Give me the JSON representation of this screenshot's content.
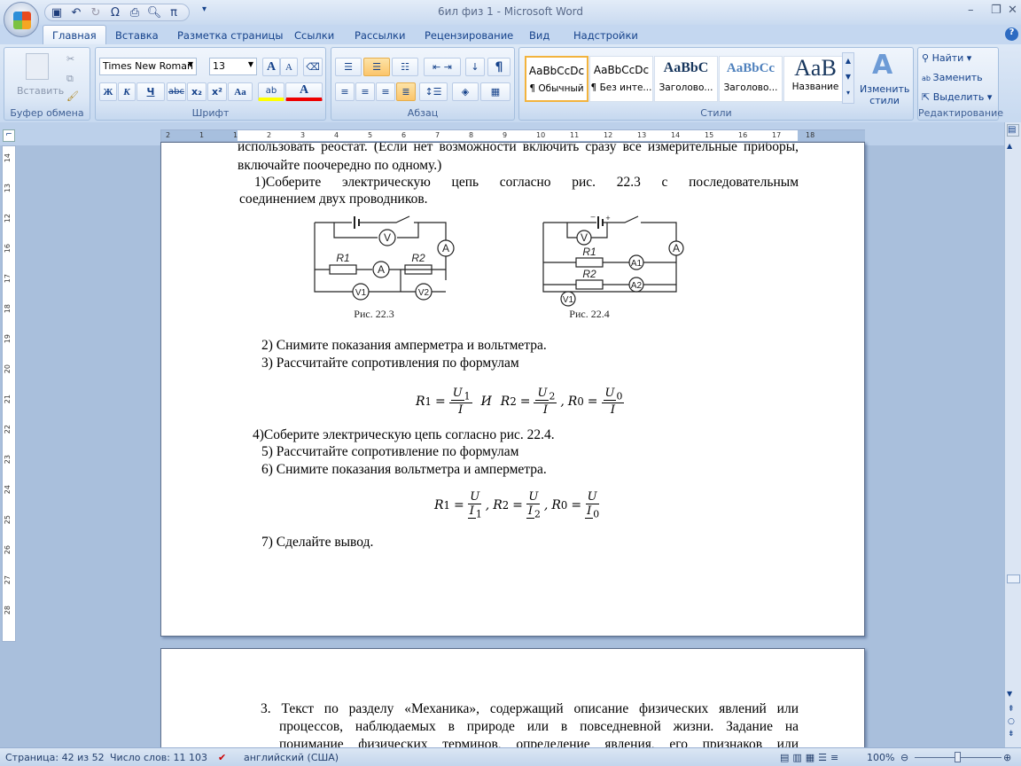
{
  "window": {
    "title": "6ил физ 1 - Microsoft Word",
    "minimize": "–",
    "restore": "❐",
    "close": "✕"
  },
  "qat": {
    "icons": [
      "save-icon",
      "undo-icon",
      "redo-icon",
      "symbol-omega-icon",
      "print-icon",
      "print-preview-icon",
      "pi-equation-icon"
    ],
    "omega": "Ω",
    "pi": "π"
  },
  "tabs": [
    "Главная",
    "Вставка",
    "Разметка страницы",
    "Ссылки",
    "Рассылки",
    "Рецензирование",
    "Вид",
    "Надстройки"
  ],
  "ribbon": {
    "clipboard": {
      "label": "Буфер обмена",
      "paste": "Вставить"
    },
    "font": {
      "label": "Шрифт",
      "name": "Times New Roman",
      "size": "13",
      "bold": "Ж",
      "italic": "К",
      "underline": "Ч",
      "strike": "abc",
      "sub": "x₂",
      "sup": "x²",
      "case": "Aa",
      "grow": "A",
      "shrink": "A",
      "color": "A",
      "highlight": "ab"
    },
    "paragraph": {
      "label": "Абзац",
      "pilcrow": "¶"
    },
    "styles": {
      "label": "Стили",
      "items": [
        {
          "preview": "AaBbCcDc",
          "name": "¶ Обычный"
        },
        {
          "preview": "AaBbCcDc",
          "name": "¶ Без инте..."
        },
        {
          "preview": "AaBbC",
          "name": "Заголово..."
        },
        {
          "preview": "AaBbCc",
          "name": "Заголово..."
        },
        {
          "preview": "AaB",
          "name": "Название"
        }
      ],
      "change": "Изменить стили"
    },
    "editing": {
      "label": "Редактирование",
      "find": "Найти",
      "replace": "Заменить",
      "select": "Выделить"
    }
  },
  "ruler": {
    "h": [
      "2",
      "1",
      "1",
      "2",
      "3",
      "4",
      "5",
      "6",
      "7",
      "8",
      "9",
      "10",
      "11",
      "12",
      "13",
      "14",
      "15",
      "16",
      "17",
      "18"
    ],
    "v": [
      "14",
      "13",
      "12",
      "16",
      "17",
      "18",
      "19",
      "20",
      "21",
      "22",
      "23",
      "24",
      "25",
      "26",
      "27",
      "28"
    ]
  },
  "doc": {
    "p0": "использовать реостат. (Если нет возможности включить сразу все измерительные приборы,",
    "p1": "включайте поочередно по одному.)",
    "s1a": "1)Соберите электрическую цепь согласно рис. 22.3 с последовательным",
    "s1b": "соединением двух проводников.",
    "fig1": {
      "caption": "Рис. 22.3",
      "labels": [
        "V",
        "A",
        "R1",
        "A",
        "R2",
        "V1",
        "V2"
      ]
    },
    "fig2": {
      "caption": "Рис. 22.4",
      "labels": [
        "V",
        "A",
        "R1",
        "A1",
        "R2",
        "A2",
        "V1",
        "–",
        "+"
      ]
    },
    "s2": "2)   Снимите показания амперметра и вольтметра.",
    "s3": "3)   Рассчитайте сопротивления по формулам",
    "f1": {
      "r1": "R",
      "s1": "1",
      "eq": "=",
      "n1": "U",
      "ns1": "1",
      "d1": "I",
      "and": "И",
      "r2": "R",
      "s2": "2",
      "n2": "U",
      "ns2": "2",
      "d2": "I",
      "r0": "R",
      "s0": "0",
      "n0": "U",
      "ns0": "0",
      "d0": "I"
    },
    "s4": "4)Соберите электрическую цепь согласно рис. 22.4.",
    "s5": "5)   Рассчитайте сопротивление по формулам",
    "s6": "6)   Снимите показания вольтметра и амперметра.",
    "f2": {
      "r": "R",
      "n": "U",
      "d": "I",
      "s1": "1",
      "s2": "2",
      "s0": "0"
    },
    "s7": "7)   Сделайте вывод.",
    "page2a": "3. Текст по разделу «Механика», содержащий описание физических явлений или",
    "page2b": "процессов, наблюдаемых в природе или в повседневной жизни. Задание на",
    "page2c": "понимание физических терминов, определение явления, его признаков или"
  },
  "status": {
    "page": "Страница: 42 из 52",
    "words": "Число слов: 11 103",
    "lang": "английский (США)",
    "zoom": "100%",
    "zoom_fraction": 0.5
  }
}
